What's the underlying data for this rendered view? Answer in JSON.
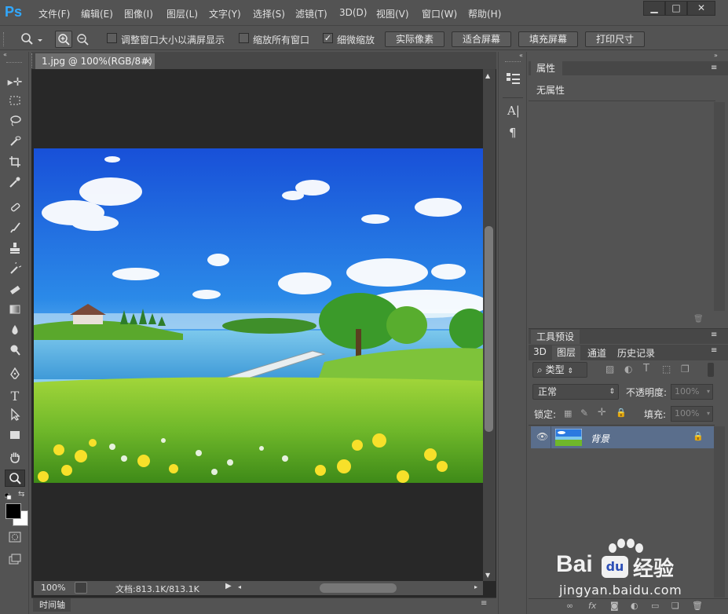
{
  "app": {
    "logo": "Ps"
  },
  "menu": [
    "文件(F)",
    "编辑(E)",
    "图像(I)",
    "图层(L)",
    "文字(Y)",
    "选择(S)",
    "滤镜(T)",
    "3D(D)",
    "视图(V)",
    "窗口(W)",
    "帮助(H)"
  ],
  "window_buttons": {
    "minimize": "▁",
    "restore": "□",
    "close": "✕"
  },
  "options": {
    "resize_windows_label": "调整窗口大小以满屏显示",
    "resize_windows_checked": false,
    "zoom_all_label": "缩放所有窗口",
    "zoom_all_checked": false,
    "scrubby_zoom_label": "细微缩放",
    "scrubby_zoom_checked": true,
    "btn_actual": "实际像素",
    "btn_fit": "适合屏幕",
    "btn_fill": "填充屏幕",
    "btn_print": "打印尺寸"
  },
  "document": {
    "tab_title": "1.jpg @ 100%(RGB/8#)",
    "tab_close": "×",
    "zoom": "100%",
    "doc_info": "文档:813.1K/813.1K"
  },
  "timeline_label": "时间轴",
  "properties": {
    "tab": "属性",
    "no_properties": "无属性"
  },
  "tool_presets_tab": "工具预设",
  "layers": {
    "tabs": [
      "3D",
      "图层",
      "通道",
      "历史记录"
    ],
    "filter_kind": "类型",
    "blend_mode": "正常",
    "opacity_label": "不透明度:",
    "opacity_value": "100%",
    "lock_label": "锁定:",
    "fill_label": "填充:",
    "fill_value": "100%",
    "layer_name": "背景"
  },
  "watermark": {
    "brand": "Bai",
    "brand2": "经验",
    "url": "jingyan.baidu.com"
  },
  "colors": {
    "ui_bg": "#535353",
    "canvas_bg": "#282828",
    "ps_blue": "#31a8ff",
    "layer_selected": "#5a6e8c"
  }
}
